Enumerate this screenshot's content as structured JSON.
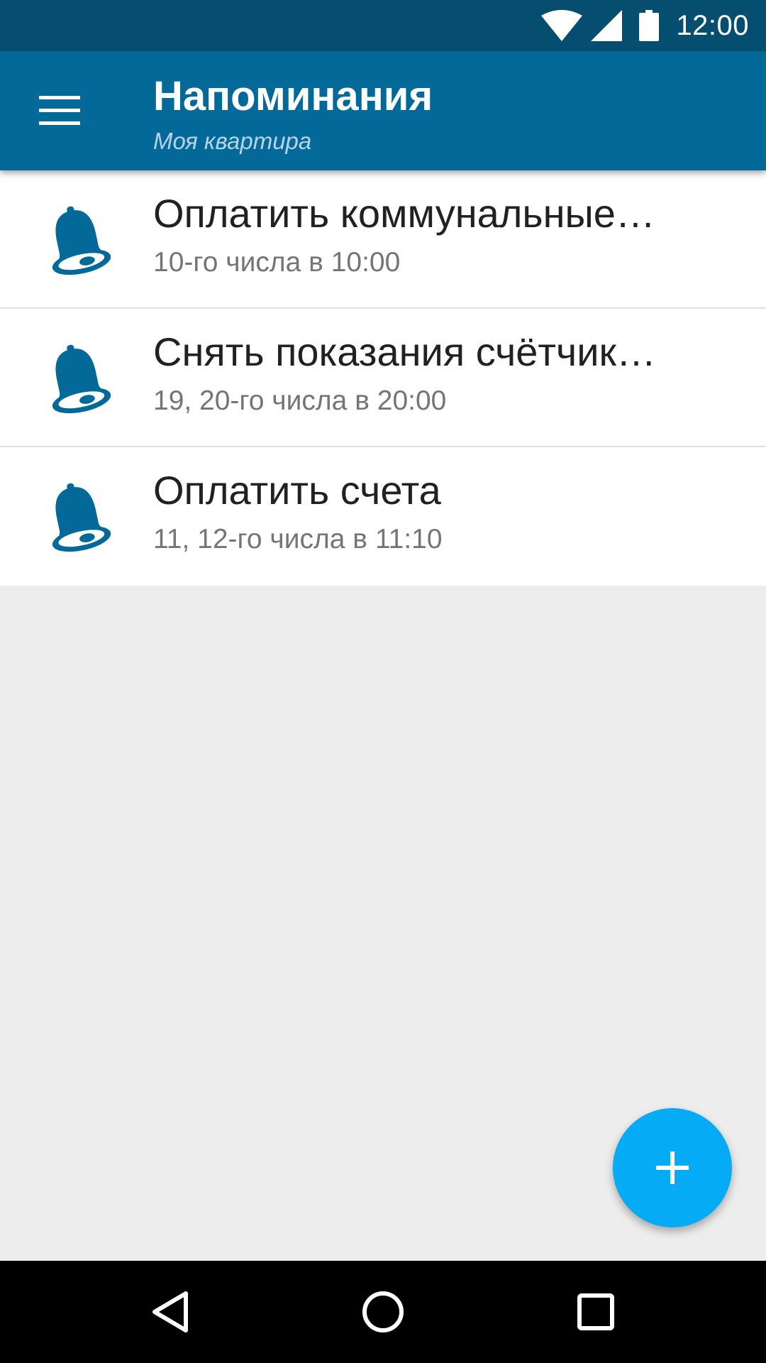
{
  "status_bar": {
    "time": "12:00",
    "icons": [
      "wifi-icon",
      "signal-icon",
      "battery-icon"
    ]
  },
  "app_bar": {
    "title": "Напоминания",
    "subtitle": "Моя квартира",
    "menu_icon": "hamburger-menu-icon"
  },
  "reminders": [
    {
      "title": "Оплатить коммунальные…",
      "schedule": "10-го числа в 10:00",
      "icon": "bell-icon"
    },
    {
      "title": "Снять показания счётчик…",
      "schedule": "19, 20-го числа в 20:00",
      "icon": "bell-icon"
    },
    {
      "title": "Оплатить счета",
      "schedule": "11, 12-го числа в 11:10",
      "icon": "bell-icon"
    }
  ],
  "fab": {
    "icon": "plus-icon"
  },
  "nav_bar": {
    "icons": [
      "back-icon",
      "home-icon",
      "recent-apps-icon"
    ]
  },
  "colors": {
    "status_bar": "#054e6f",
    "app_bar": "#036999",
    "accent": "#05abf5",
    "bell": "#036999",
    "background": "#ededed"
  }
}
